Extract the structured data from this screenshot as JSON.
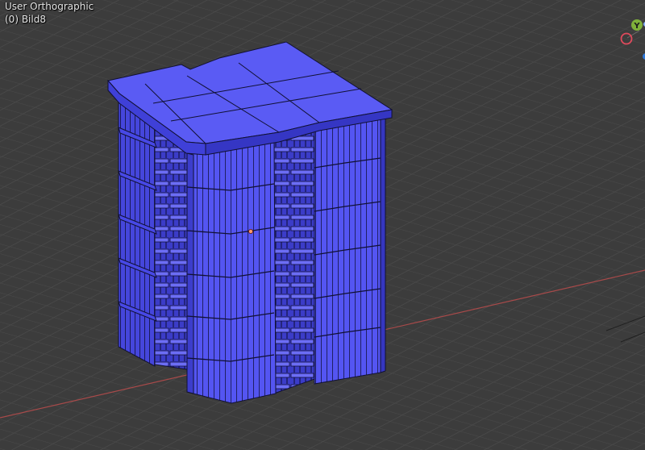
{
  "viewport": {
    "view_name": "User Orthographic",
    "object_name": "(0) Bild8"
  },
  "gizmo": {
    "y_label": "Y",
    "colors": {
      "x": "#e04a5c",
      "y": "#7fb13a",
      "z": "#2f78d8"
    }
  },
  "scene": {
    "object_color": "#5253f0",
    "object_shade": "#3b3cd2",
    "edge_color": "#111122",
    "grid_color": "#4a4a4a",
    "x_axis_color": "#a34a4a"
  }
}
